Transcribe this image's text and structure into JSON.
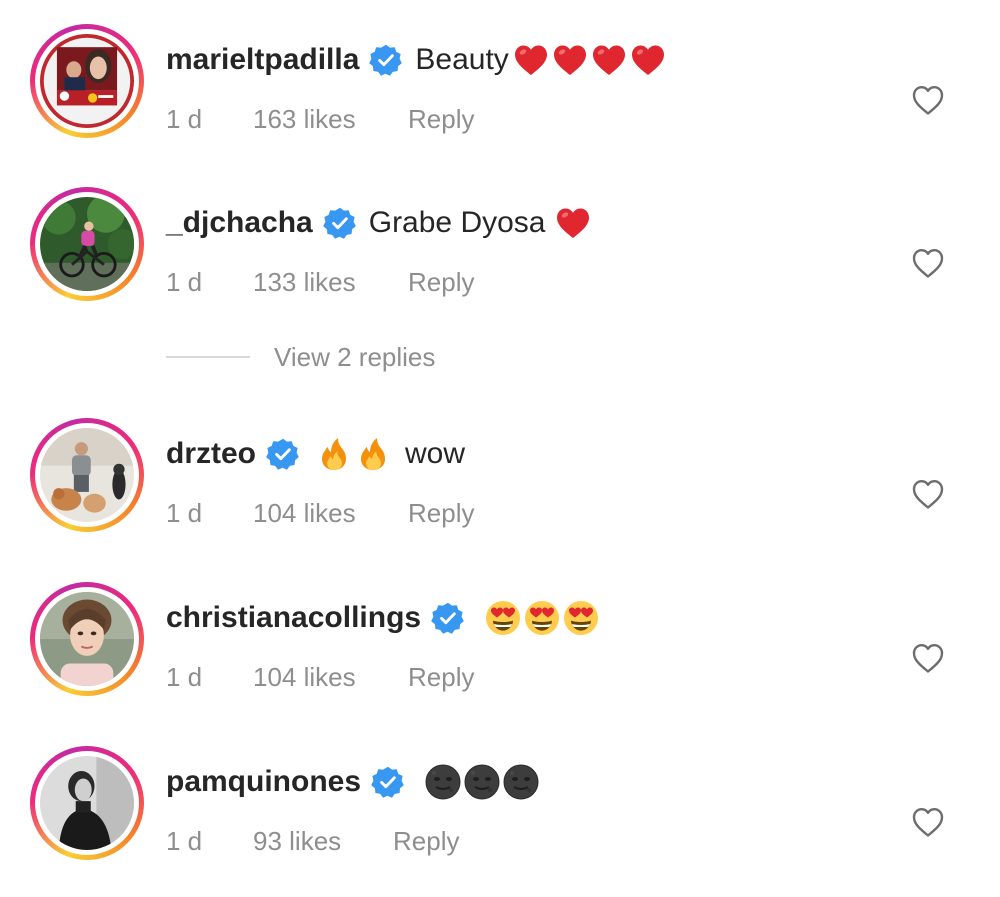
{
  "comments": [
    {
      "username": "marieltpadilla",
      "text": "Beauty",
      "emojis": [
        "red-heart",
        "red-heart",
        "red-heart",
        "red-heart"
      ],
      "time": "1 d",
      "likes": "163 likes",
      "reply_label": "Reply"
    },
    {
      "username": "_djchacha",
      "text": "Grabe Dyosa",
      "emojis": [
        "red-heart"
      ],
      "time": "1 d",
      "likes": "133 likes",
      "reply_label": "Reply"
    },
    {
      "username": "drzteo",
      "text": "wow",
      "emojis": [
        "fire",
        "fire"
      ],
      "time": "1 d",
      "likes": "104 likes",
      "reply_label": "Reply"
    },
    {
      "username": "christianacollings",
      "text": "",
      "emojis": [
        "heart-eyes",
        "heart-eyes",
        "heart-eyes"
      ],
      "time": "1 d",
      "likes": "104 likes",
      "reply_label": "Reply"
    },
    {
      "username": "pamquinones",
      "text": "",
      "emojis": [
        "new-moon-face",
        "new-moon-face",
        "new-moon-face"
      ],
      "time": "1 d",
      "likes": "93 likes",
      "reply_label": "Reply"
    }
  ],
  "view_replies_label": "View 2 replies",
  "colors": {
    "text": "#262626",
    "muted": "#8e8e8e",
    "verified": "#3897f0",
    "heart_red": "#e0262e",
    "ring_start": "#f9ce34",
    "ring_mid": "#ee2a7b",
    "ring_end": "#c32aa3"
  },
  "icons": {
    "verified": "verified-badge-icon",
    "like": "heart-outline-icon"
  }
}
